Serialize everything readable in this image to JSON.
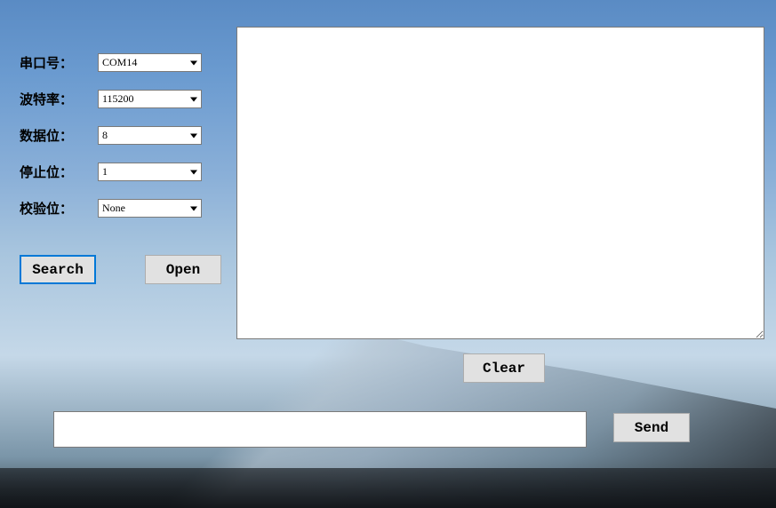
{
  "config": {
    "port": {
      "label": "串口号：",
      "value": "COM14"
    },
    "baud": {
      "label": "波特率：",
      "value": "115200"
    },
    "databits": {
      "label": "数据位：",
      "value": "8"
    },
    "stopbits": {
      "label": "停止位：",
      "value": "1"
    },
    "parity": {
      "label": "校验位：",
      "value": "None"
    }
  },
  "buttons": {
    "search": "Search",
    "open": "Open",
    "clear": "Clear",
    "send": "Send"
  },
  "output": "",
  "input": ""
}
